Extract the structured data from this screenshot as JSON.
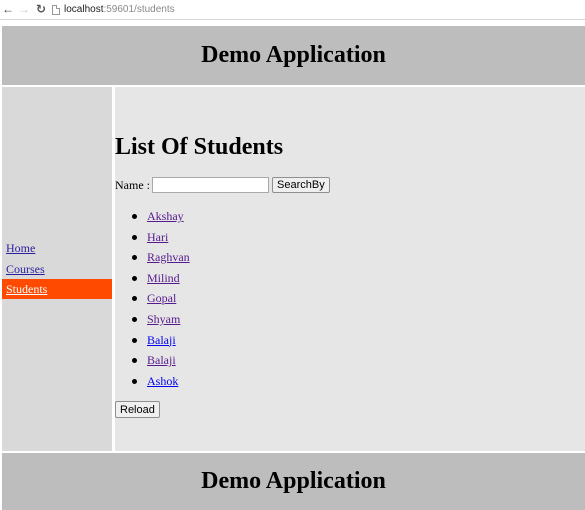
{
  "browser": {
    "url_host": "localhost",
    "url_path": ":59601/students"
  },
  "header": {
    "title": "Demo Application"
  },
  "sidebar": {
    "items": [
      {
        "label": "Home"
      },
      {
        "label": "Courses"
      },
      {
        "label": "Students",
        "active": true
      }
    ]
  },
  "main": {
    "heading": "List Of Students",
    "search": {
      "label": "Name :",
      "value": "",
      "button_label": "SearchBy"
    },
    "students": [
      {
        "name": "Akshay"
      },
      {
        "name": "Hari"
      },
      {
        "name": "Raghvan"
      },
      {
        "name": "Milind"
      },
      {
        "name": "Gopal"
      },
      {
        "name": "Shyam"
      },
      {
        "name": "Balaji"
      },
      {
        "name": "Balaji"
      },
      {
        "name": "Ashok"
      }
    ],
    "reload_label": "Reload"
  },
  "footer": {
    "title": "Demo Application"
  },
  "colors": {
    "header_bg": "#bdbdbd",
    "sidebar_bg": "#d9d9d9",
    "main_bg": "#e6e6e6",
    "active_nav_bg": "#ff4a00",
    "visited_link": "#551a8b",
    "link": "#0000ee"
  },
  "icons": [
    "back-arrow-icon",
    "forward-arrow-icon",
    "reload-icon",
    "page-icon"
  ]
}
